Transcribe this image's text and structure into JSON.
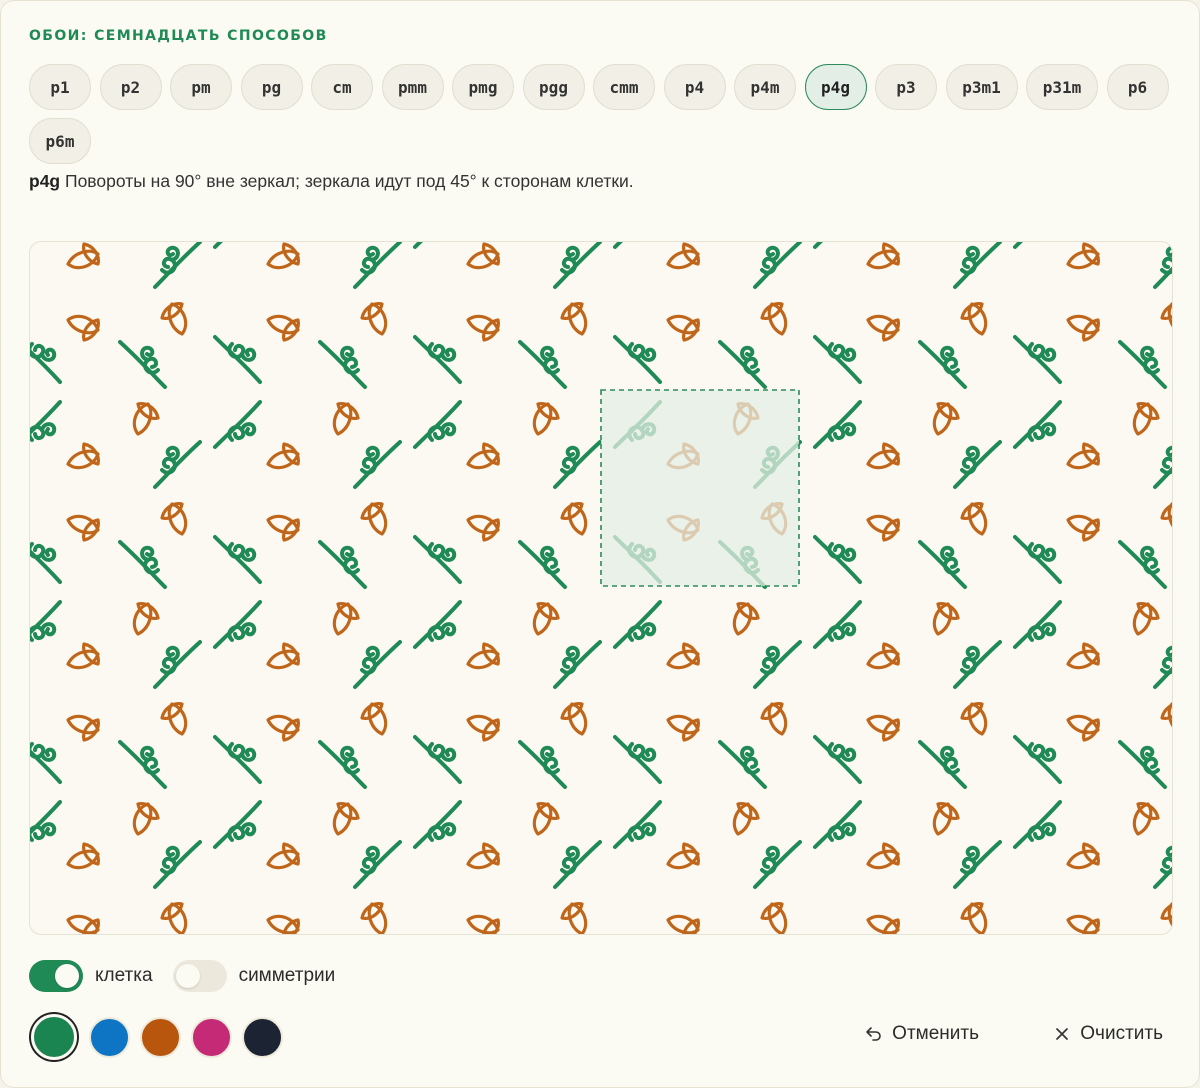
{
  "title": "ОБОИ: СЕМНАДЦАТЬ СПОСОБОВ",
  "groups": [
    "p1",
    "p2",
    "pm",
    "pg",
    "cm",
    "pmm",
    "pmg",
    "pgg",
    "cmm",
    "p4",
    "p4m",
    "p4g",
    "p3",
    "p3m1",
    "p31m",
    "p6",
    "p6m"
  ],
  "active_group": "p4g",
  "description": {
    "code": "p4g",
    "text": "Повороты на 90° вне зеркал; зеркала идут под 45° к сторонам клетки."
  },
  "toggles": [
    {
      "label": "клетка",
      "on": true
    },
    {
      "label": "симметрии",
      "on": false
    }
  ],
  "colors": [
    "#1b8551",
    "#0e74c4",
    "#b8560e",
    "#c42a75",
    "#1c2433"
  ],
  "selected_color": "#1b8551",
  "pattern": {
    "motif_green": "#1f8a55",
    "motif_orange": "#c0661b",
    "cell_fill": "#e4eee4"
  },
  "actions": {
    "undo": "Отменить",
    "clear": "Очистить"
  },
  "icons": {
    "undo": "undo-arrow-icon",
    "clear": "close-x-icon"
  }
}
